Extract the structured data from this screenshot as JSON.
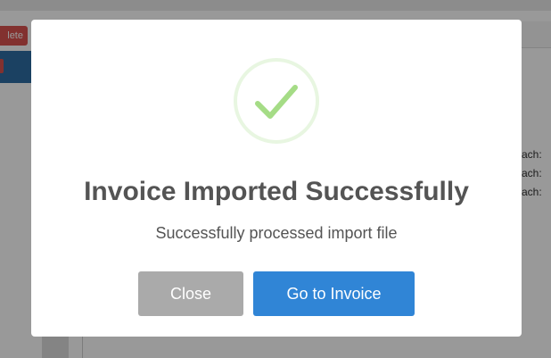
{
  "background": {
    "delete_button_label": "lete",
    "attachment_labels": [
      "ach:",
      "ach:",
      "ach:"
    ]
  },
  "modal": {
    "icon": "success-checkmark-icon",
    "title": "Invoice Imported Successfully",
    "message": "Successfully processed import file",
    "buttons": {
      "close_label": "Close",
      "goto_label": "Go to Invoice"
    }
  },
  "colors": {
    "checkmark": "#a5dc86",
    "close_button": "#aaaaaa",
    "goto_button": "#3085d6",
    "title_text": "#545454",
    "danger": "#d9534f",
    "navbar": "#2e6da4"
  }
}
